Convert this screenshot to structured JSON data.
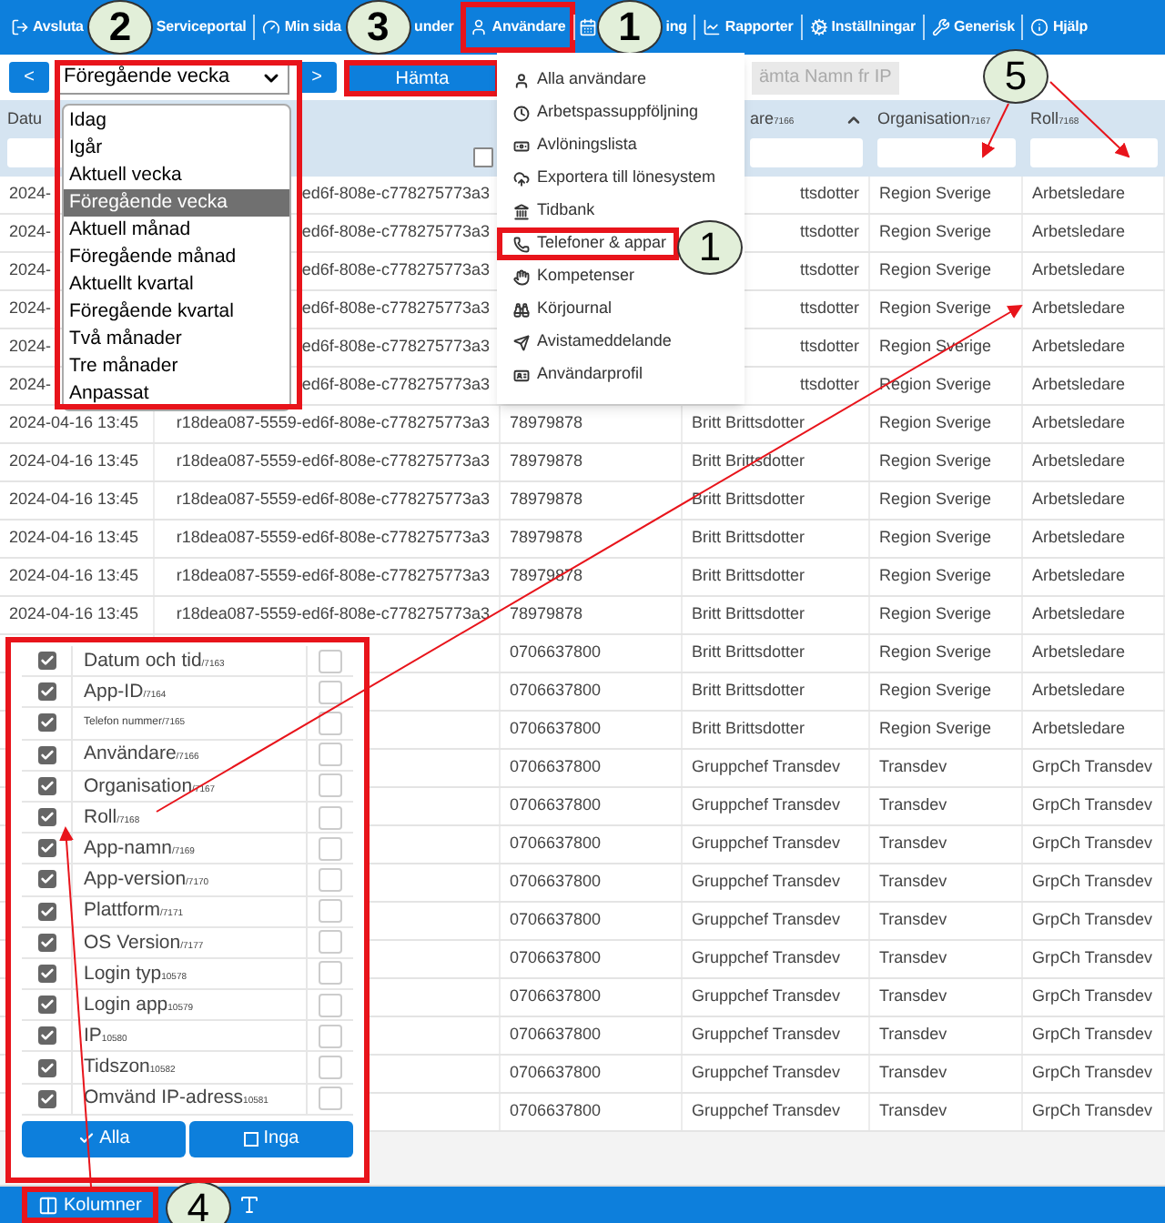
{
  "nav": [
    {
      "label": "Avsluta",
      "highlighted": false
    },
    {
      "label": "Serviceportal",
      "highlighted": false
    },
    {
      "label": "Min sida",
      "highlighted": false
    },
    {
      "label": "under",
      "highlighted": false
    },
    {
      "label": "Användare",
      "highlighted": true
    },
    {
      "label": "ing",
      "highlighted": false
    },
    {
      "label": "Rapporter",
      "highlighted": false
    },
    {
      "label": "Inställningar",
      "highlighted": false
    },
    {
      "label": "Generisk",
      "highlighted": false
    },
    {
      "label": "Hjälp",
      "highlighted": false
    }
  ],
  "callouts": [
    {
      "number": "2"
    },
    {
      "number": "3"
    },
    {
      "number": "1"
    },
    {
      "number": "1"
    },
    {
      "number": "5"
    },
    {
      "number": "4"
    }
  ],
  "toolbar": {
    "prev": "<",
    "next": ">",
    "fetch": {
      "label": "Hämta",
      "highlighted": true
    },
    "fetch_names": "ämta Namn fr IP"
  },
  "period_select": {
    "value": "Föregående vecka",
    "options": [
      {
        "label": "Idag",
        "selected": false
      },
      {
        "label": "Igår",
        "selected": false
      },
      {
        "label": "Aktuell vecka",
        "selected": false
      },
      {
        "label": "Föregående vecka",
        "selected": true
      },
      {
        "label": "Aktuell månad",
        "selected": false
      },
      {
        "label": "Föregående månad",
        "selected": false
      },
      {
        "label": "Aktuellt kvartal",
        "selected": false
      },
      {
        "label": "Föregående kvartal",
        "selected": false
      },
      {
        "label": "Två månader",
        "selected": false
      },
      {
        "label": "Tre månader",
        "selected": false
      },
      {
        "label": "Anpassat",
        "selected": false
      }
    ]
  },
  "user_menu": [
    {
      "label": "Alla användare",
      "highlighted": false
    },
    {
      "label": "Arbetspassuppföljning",
      "highlighted": false
    },
    {
      "label": "Avlöningslista",
      "highlighted": false
    },
    {
      "label": "Exportera till lönesystem",
      "highlighted": false
    },
    {
      "label": "Tidbank",
      "highlighted": false
    },
    {
      "label": "Telefoner & appar",
      "highlighted": true
    },
    {
      "label": "Kompetenser",
      "highlighted": false
    },
    {
      "label": "Körjournal",
      "highlighted": false
    },
    {
      "label": "Avistameddelande",
      "highlighted": false
    },
    {
      "label": "Användarprofil",
      "highlighted": false
    }
  ],
  "table": {
    "select_all_checked": false,
    "columns": [
      {
        "label": "Datu"
      },
      {},
      {},
      {
        "label": "are",
        "code": "7166"
      },
      {
        "label": "Organisation",
        "code": "7167"
      },
      {
        "label": "Roll",
        "code": "7168"
      }
    ],
    "rows": [
      {
        "date": "2024-",
        "app_id": "ed6f-808e-c778275773a3",
        "user": "ttsdotter",
        "org": "Region Sverige",
        "role": "Arbetsledare"
      },
      {
        "date": "2024-",
        "app_id": "ed6f-808e-c778275773a3",
        "user": "ttsdotter",
        "org": "Region Sverige",
        "role": "Arbetsledare"
      },
      {
        "date": "2024-",
        "app_id": "ed6f-808e-c778275773a3",
        "user": "ttsdotter",
        "org": "Region Sverige",
        "role": "Arbetsledare"
      },
      {
        "date": "2024-",
        "app_id": "ed6f-808e-c778275773a3",
        "user": "ttsdotter",
        "org": "Region Sverige",
        "role": "Arbetsledare"
      },
      {
        "date": "2024-",
        "app_id": "ed6f-808e-c778275773a3",
        "user": "ttsdotter",
        "org": "Region Sverige",
        "role": "Arbetsledare"
      },
      {
        "date": "2024-",
        "app_id": "ed6f-808e-c778275773a3",
        "user": "ttsdotter",
        "org": "Region Sverige",
        "role": "Arbetsledare"
      },
      {
        "date": "2024-04-16 13:45",
        "app_id": "r18dea087-5559-ed6f-808e-c778275773a3",
        "phone": "78979878",
        "user": "Britt Brittsdotter",
        "org": "Region Sverige",
        "role": "Arbetsledare"
      },
      {
        "date": "2024-04-16 13:45",
        "app_id": "r18dea087-5559-ed6f-808e-c778275773a3",
        "phone": "78979878",
        "user": "Britt Brittsdotter",
        "org": "Region Sverige",
        "role": "Arbetsledare"
      },
      {
        "date": "2024-04-16 13:45",
        "app_id": "r18dea087-5559-ed6f-808e-c778275773a3",
        "phone": "78979878",
        "user": "Britt Brittsdotter",
        "org": "Region Sverige",
        "role": "Arbetsledare"
      },
      {
        "date": "2024-04-16 13:45",
        "app_id": "r18dea087-5559-ed6f-808e-c778275773a3",
        "phone": "78979878",
        "user": "Britt Brittsdotter",
        "org": "Region Sverige",
        "role": "Arbetsledare"
      },
      {
        "date": "2024-04-16 13:45",
        "app_id": "r18dea087-5559-ed6f-808e-c778275773a3",
        "phone": "78979878",
        "user": "Britt Brittsdotter",
        "org": "Region Sverige",
        "role": "Arbetsledare"
      },
      {
        "date": "2024-04-16 13:45",
        "app_id": "r18dea087-5559-ed6f-808e-c778275773a3",
        "phone": "78979878",
        "user": "Britt Brittsdotter",
        "org": "Region Sverige",
        "role": "Arbetsledare"
      },
      {
        "phone": "0706637800",
        "user": "Britt Brittsdotter",
        "org": "Region Sverige",
        "role": "Arbetsledare"
      },
      {
        "phone": "0706637800",
        "user": "Britt Brittsdotter",
        "org": "Region Sverige",
        "role": "Arbetsledare"
      },
      {
        "phone": "0706637800",
        "user": "Britt Brittsdotter",
        "org": "Region Sverige",
        "role": "Arbetsledare"
      },
      {
        "phone": "0706637800",
        "user": "Gruppchef Transdev",
        "org": "Transdev",
        "role": "GrpCh Transdev"
      },
      {
        "phone": "0706637800",
        "user": "Gruppchef Transdev",
        "org": "Transdev",
        "role": "GrpCh Transdev"
      },
      {
        "phone": "0706637800",
        "user": "Gruppchef Transdev",
        "org": "Transdev",
        "role": "GrpCh Transdev"
      },
      {
        "phone": "0706637800",
        "user": "Gruppchef Transdev",
        "org": "Transdev",
        "role": "GrpCh Transdev"
      },
      {
        "phone": "0706637800",
        "user": "Gruppchef Transdev",
        "org": "Transdev",
        "role": "GrpCh Transdev"
      },
      {
        "phone": "0706637800",
        "user": "Gruppchef Transdev",
        "org": "Transdev",
        "role": "GrpCh Transdev"
      },
      {
        "phone": "0706637800",
        "user": "Gruppchef Transdev",
        "org": "Transdev",
        "role": "GrpCh Transdev"
      },
      {
        "phone": "0706637800",
        "user": "Gruppchef Transdev",
        "org": "Transdev",
        "role": "GrpCh Transdev"
      },
      {
        "phone": "0706637800",
        "user": "Gruppchef Transdev",
        "org": "Transdev",
        "role": "GrpCh Transdev"
      },
      {
        "phone": "0706637800",
        "user": "Gruppchef Transdev",
        "org": "Transdev",
        "role": "GrpCh Transdev"
      }
    ]
  },
  "column_panel": {
    "columns": [
      {
        "label": "Datum och tid",
        "code": "/7163",
        "kind": "normal",
        "checked": true,
        "checked_right": false
      },
      {
        "label": "App-ID",
        "code": "/7164",
        "kind": "normal",
        "checked": true,
        "checked_right": false
      },
      {
        "label": "Telefon nummer",
        "code": "/7165",
        "kind": "small",
        "checked": true,
        "checked_right": false
      },
      {
        "label": "Användare",
        "code": "/7166",
        "kind": "normal",
        "checked": true,
        "checked_right": false
      },
      {
        "label": "Organisation",
        "code": "/7167",
        "kind": "normal",
        "checked": true,
        "checked_right": false
      },
      {
        "label": "Roll",
        "code": "/7168",
        "kind": "normal",
        "checked": true,
        "checked_right": false
      },
      {
        "label": "App-namn",
        "code": "/7169",
        "kind": "normal",
        "checked": true,
        "checked_right": false
      },
      {
        "label": "App-version",
        "code": "/7170",
        "kind": "normal",
        "checked": true,
        "checked_right": false
      },
      {
        "label": "Plattform",
        "code": "/7171",
        "kind": "normal",
        "checked": true,
        "checked_right": false
      },
      {
        "label": "OS Version",
        "code": "/7177",
        "kind": "normal",
        "checked": true,
        "checked_right": false
      },
      {
        "label": "Login typ",
        "code": "10578",
        "kind": "normal",
        "checked": true,
        "checked_right": false
      },
      {
        "label": "Login app",
        "code": "10579",
        "kind": "normal",
        "checked": true,
        "checked_right": false
      },
      {
        "label": "IP",
        "code": "10580",
        "kind": "normal",
        "checked": true,
        "checked_right": false
      },
      {
        "label": "Tidszon",
        "code": "10582",
        "kind": "normal",
        "checked": true,
        "checked_right": false
      },
      {
        "label": "Omvänd IP-adress",
        "code": "10581",
        "kind": "normal",
        "checked": true,
        "checked_right": false
      }
    ],
    "all_button": "Alla",
    "none_button": "Inga"
  },
  "bottom_bar": {
    "columns_button": {
      "label": "Kolumner",
      "highlighted": true
    }
  }
}
